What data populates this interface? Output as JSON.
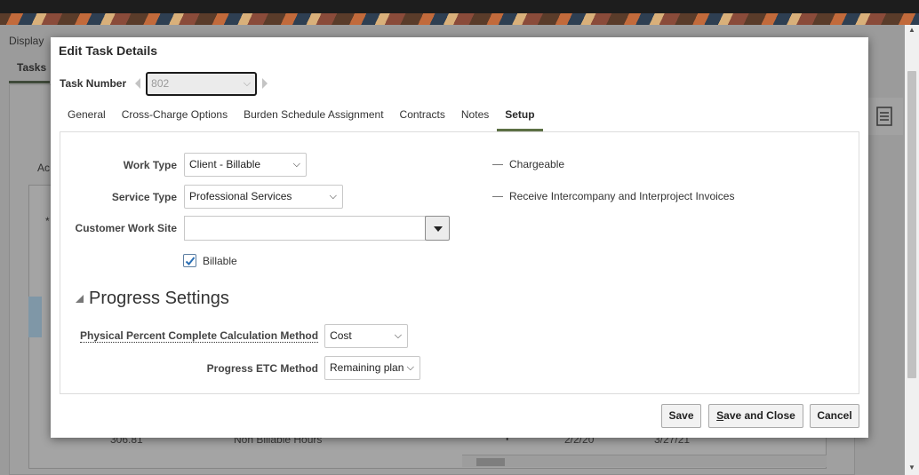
{
  "background": {
    "display_label": "Display",
    "tab_label": "Tasks",
    "ac_label": "Ac",
    "asterisk": "*",
    "row_value": "306.81",
    "row_text": "Non Billable Hours",
    "row_date1": "2/2/20",
    "row_date2": "3/27/21",
    "row_plus": "+"
  },
  "dialog": {
    "title": "Edit Task Details",
    "task_number_label": "Task Number",
    "task_number_value": "802",
    "tabs": [
      {
        "label": "General"
      },
      {
        "label": "Cross-Charge Options"
      },
      {
        "label": "Burden Schedule Assignment"
      },
      {
        "label": "Contracts"
      },
      {
        "label": "Notes"
      },
      {
        "label": "Setup"
      }
    ],
    "active_tab": "Setup",
    "fields": {
      "work_type": {
        "label": "Work Type",
        "value": "Client - Billable"
      },
      "service_type": {
        "label": "Service Type",
        "value": "Professional Services"
      },
      "customer_work_site": {
        "label": "Customer Work Site",
        "value": ""
      },
      "billable": {
        "label": "Billable",
        "checked": true
      },
      "chargeable": {
        "label": "Chargeable"
      },
      "receive_invoices": {
        "label": "Receive Intercompany and Interproject Invoices"
      }
    },
    "progress": {
      "title": "Progress Settings",
      "calc_method": {
        "label": "Physical Percent Complete Calculation Method",
        "value": "Cost"
      },
      "etc_method": {
        "label": "Progress ETC Method",
        "value": "Remaining plan"
      }
    },
    "buttons": {
      "save": "Save",
      "save_close_mnemonic": "S",
      "save_close_rest": "ave and Close",
      "cancel": "Cancel"
    }
  },
  "colors": {
    "tab_underline": "#5c7044",
    "checkbox_check": "#2a6fb5"
  }
}
